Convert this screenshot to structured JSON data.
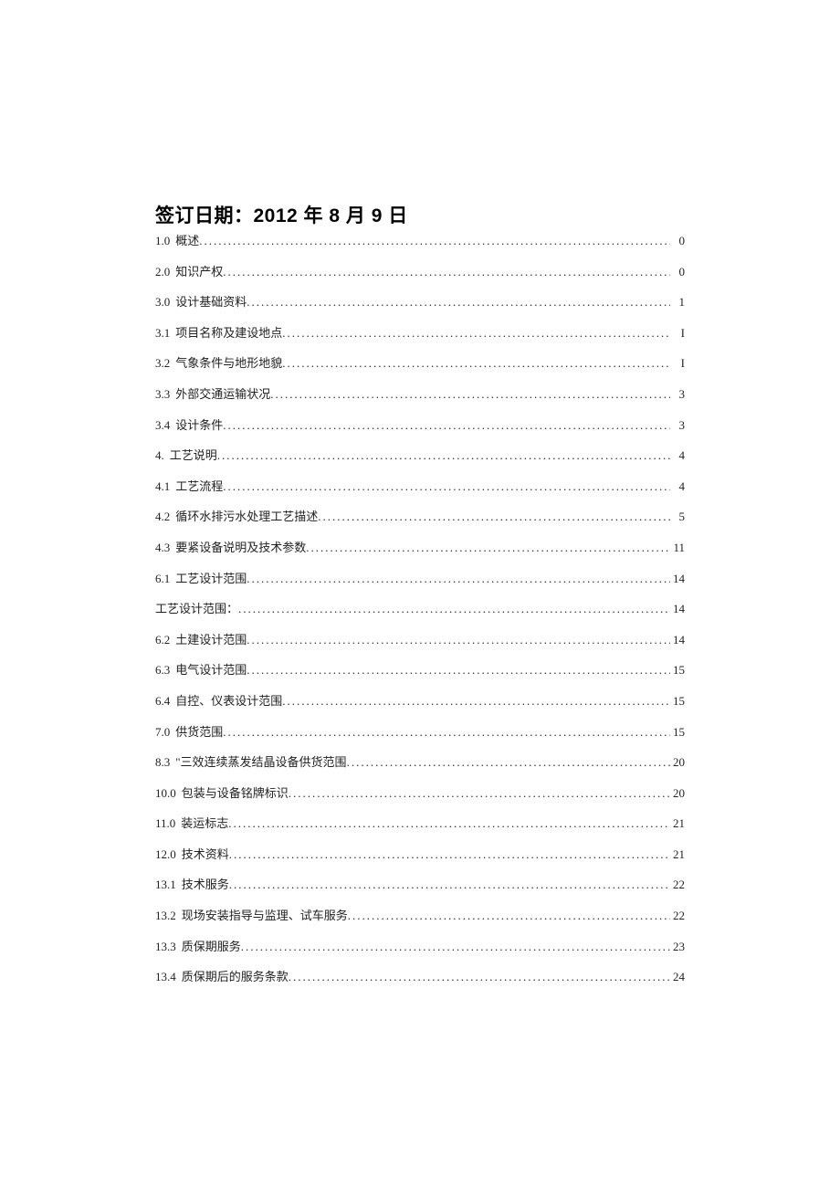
{
  "title": "签订日期：2012 年 8 月 9 日",
  "toc": [
    {
      "num": "1.0",
      "text": "概述",
      "page": "0"
    },
    {
      "num": "2.0",
      "text": "知识产权",
      "page": "0"
    },
    {
      "num": "3.0",
      "text": "设计基础资料",
      "page": "1"
    },
    {
      "num": "3.1",
      "text": "项目名称及建设地点",
      "page": "I"
    },
    {
      "num": "3.2",
      "text": "气象条件与地形地貌",
      "page": "I"
    },
    {
      "num": "3.3",
      "text": "外部交通运输状况",
      "page": "3"
    },
    {
      "num": "3.4",
      "text": "设计条件 ",
      "page": "3"
    },
    {
      "num": "4.",
      "text": "工艺说明 ",
      "page": "4"
    },
    {
      "num": "4.1",
      "text": "工艺流程",
      "page": "4"
    },
    {
      "num": "4.2",
      "text": " 循环水排污水处理工艺描述 ",
      "page": "5"
    },
    {
      "num": "4.3",
      "text": "要紧设备说明及技术参数 ",
      "page": "11"
    },
    {
      "num": "6.1",
      "text": "工艺设计范围",
      "page": "14"
    },
    {
      "num": "",
      "text": "工艺设计范围： ",
      "page": "14"
    },
    {
      "num": "6.2",
      "text": "土建设计范围 ",
      "page": "14"
    },
    {
      "num": "6.3",
      "text": "电气设计范围",
      "page": "15"
    },
    {
      "num": "6.4",
      "text": "自控、仪表设计范围 ",
      "page": "15"
    },
    {
      "num": "7.0",
      "text": "供货范围",
      "page": "15"
    },
    {
      "num": "8.3",
      "text": "\"三效连续蒸发结晶设备供货范围 ",
      "page": "20"
    },
    {
      "num": "10.0",
      "text": "包装与设备铭牌标识",
      "page": "20"
    },
    {
      "num": "11.0",
      "text": "装运标志",
      "page": "21"
    },
    {
      "num": "12.0",
      "text": "技术资料",
      "page": "21"
    },
    {
      "num": "13.1",
      "text": "技术服务",
      "page": "22"
    },
    {
      "num": "13.2",
      "text": "现场安装指导与监理、试车服务 ",
      "page": "22"
    },
    {
      "num": "13.3",
      "text": "质保期服务 ",
      "page": "23"
    },
    {
      "num": "13.4",
      "text": "质保期后的服务条款 ",
      "page": "24"
    }
  ]
}
